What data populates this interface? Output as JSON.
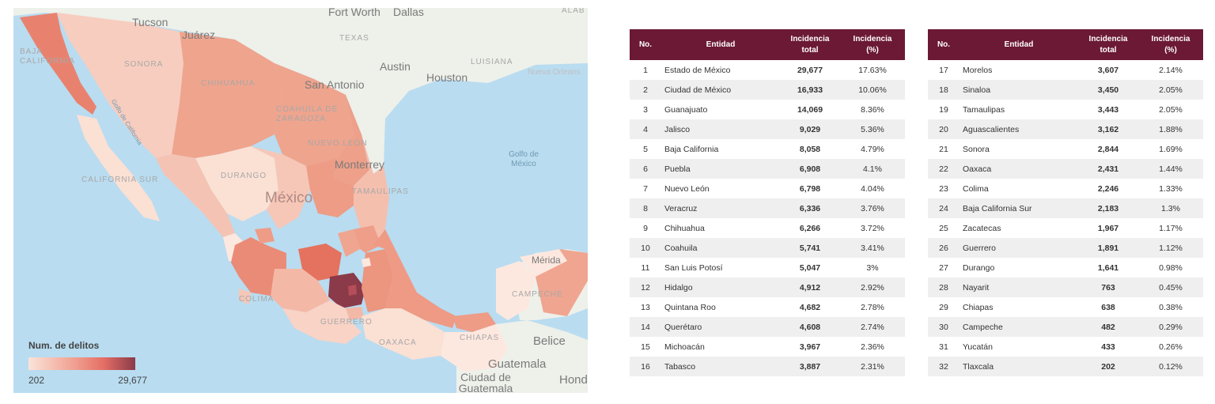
{
  "map": {
    "country_label": "México",
    "city_labels": [
      "Tucson",
      "Juárez",
      "Fort Worth",
      "Dallas",
      "Austin",
      "Houston",
      "San Antonio",
      "Monterrey",
      "Belice",
      "Guatemala",
      "Ciudad de Guatemala",
      "Hondu",
      "Mérida"
    ],
    "region_labels": [
      "TEXAS",
      "LUISIANA",
      "ALAB",
      "SONORA",
      "CHIHUAHUA",
      "COAHUILA DE ZARAGOZA",
      "NUEVO LEÓN",
      "BAJA CALIFORNIA",
      "CALIFORNIA SUR",
      "DURANGO",
      "TAMAULIPAS",
      "COLIMA",
      "GUERRERO",
      "OAXACA",
      "CHIAPAS",
      "CAMPECHE",
      "Nueva Orleans"
    ],
    "sea_labels": [
      "Golfo de México",
      "Golfo de California"
    ],
    "legend": {
      "title": "Num. de delitos",
      "min_label": "202",
      "max_label": "29,677"
    },
    "colors": {
      "sea": "#b9dcf0",
      "land": "#eef0ea",
      "lowest": "#fbe3d9",
      "highest": "#8b3a4a"
    }
  },
  "table_left": {
    "headers": {
      "no": "No.",
      "entidad": "Entidad",
      "total_line1": "Incidencia",
      "total_line2": "total",
      "pct_line1": "Incidencia",
      "pct_line2": "(%)"
    },
    "rows": [
      {
        "no": "1",
        "entidad": "Estado de México",
        "total": "29,677",
        "pct": "17.63%"
      },
      {
        "no": "2",
        "entidad": "Ciudad de México",
        "total": "16,933",
        "pct": "10.06%"
      },
      {
        "no": "3",
        "entidad": "Guanajuato",
        "total": "14,069",
        "pct": "8.36%"
      },
      {
        "no": "4",
        "entidad": "Jalisco",
        "total": "9,029",
        "pct": "5.36%"
      },
      {
        "no": "5",
        "entidad": "Baja California",
        "total": "8,058",
        "pct": "4.79%"
      },
      {
        "no": "6",
        "entidad": "Puebla",
        "total": "6,908",
        "pct": "4.1%"
      },
      {
        "no": "7",
        "entidad": "Nuevo León",
        "total": "6,798",
        "pct": "4.04%"
      },
      {
        "no": "8",
        "entidad": "Veracruz",
        "total": "6,336",
        "pct": "3.76%"
      },
      {
        "no": "9",
        "entidad": "Chihuahua",
        "total": "6,266",
        "pct": "3.72%"
      },
      {
        "no": "10",
        "entidad": "Coahuila",
        "total": "5,741",
        "pct": "3.41%"
      },
      {
        "no": "11",
        "entidad": "San Luis Potosí",
        "total": "5,047",
        "pct": "3%"
      },
      {
        "no": "12",
        "entidad": "Hidalgo",
        "total": "4,912",
        "pct": "2.92%"
      },
      {
        "no": "13",
        "entidad": "Quintana Roo",
        "total": "4,682",
        "pct": "2.78%"
      },
      {
        "no": "14",
        "entidad": "Querétaro",
        "total": "4,608",
        "pct": "2.74%"
      },
      {
        "no": "15",
        "entidad": "Michoacán",
        "total": "3,967",
        "pct": "2.36%"
      },
      {
        "no": "16",
        "entidad": "Tabasco",
        "total": "3,887",
        "pct": "2.31%"
      }
    ]
  },
  "table_right": {
    "headers": {
      "no": "No.",
      "entidad": "Entidad",
      "total_line1": "Incidencia",
      "total_line2": "total",
      "pct_line1": "Incidencia",
      "pct_line2": "(%)"
    },
    "rows": [
      {
        "no": "17",
        "entidad": "Morelos",
        "total": "3,607",
        "pct": "2.14%"
      },
      {
        "no": "18",
        "entidad": "Sinaloa",
        "total": "3,450",
        "pct": "2.05%"
      },
      {
        "no": "19",
        "entidad": "Tamaulipas",
        "total": "3,443",
        "pct": "2.05%"
      },
      {
        "no": "20",
        "entidad": "Aguascalientes",
        "total": "3,162",
        "pct": "1.88%"
      },
      {
        "no": "21",
        "entidad": "Sonora",
        "total": "2,844",
        "pct": "1.69%"
      },
      {
        "no": "22",
        "entidad": "Oaxaca",
        "total": "2,431",
        "pct": "1.44%"
      },
      {
        "no": "23",
        "entidad": "Colima",
        "total": "2,246",
        "pct": "1.33%"
      },
      {
        "no": "24",
        "entidad": "Baja California Sur",
        "total": "2,183",
        "pct": "1.3%"
      },
      {
        "no": "25",
        "entidad": "Zacatecas",
        "total": "1,967",
        "pct": "1.17%"
      },
      {
        "no": "26",
        "entidad": "Guerrero",
        "total": "1,891",
        "pct": "1.12%"
      },
      {
        "no": "27",
        "entidad": "Durango",
        "total": "1,641",
        "pct": "0.98%"
      },
      {
        "no": "28",
        "entidad": "Nayarit",
        "total": "763",
        "pct": "0.45%"
      },
      {
        "no": "29",
        "entidad": "Chiapas",
        "total": "638",
        "pct": "0.38%"
      },
      {
        "no": "30",
        "entidad": "Campeche",
        "total": "482",
        "pct": "0.29%"
      },
      {
        "no": "31",
        "entidad": "Yucatán",
        "total": "433",
        "pct": "0.26%"
      },
      {
        "no": "32",
        "entidad": "Tlaxcala",
        "total": "202",
        "pct": "0.12%"
      }
    ]
  }
}
